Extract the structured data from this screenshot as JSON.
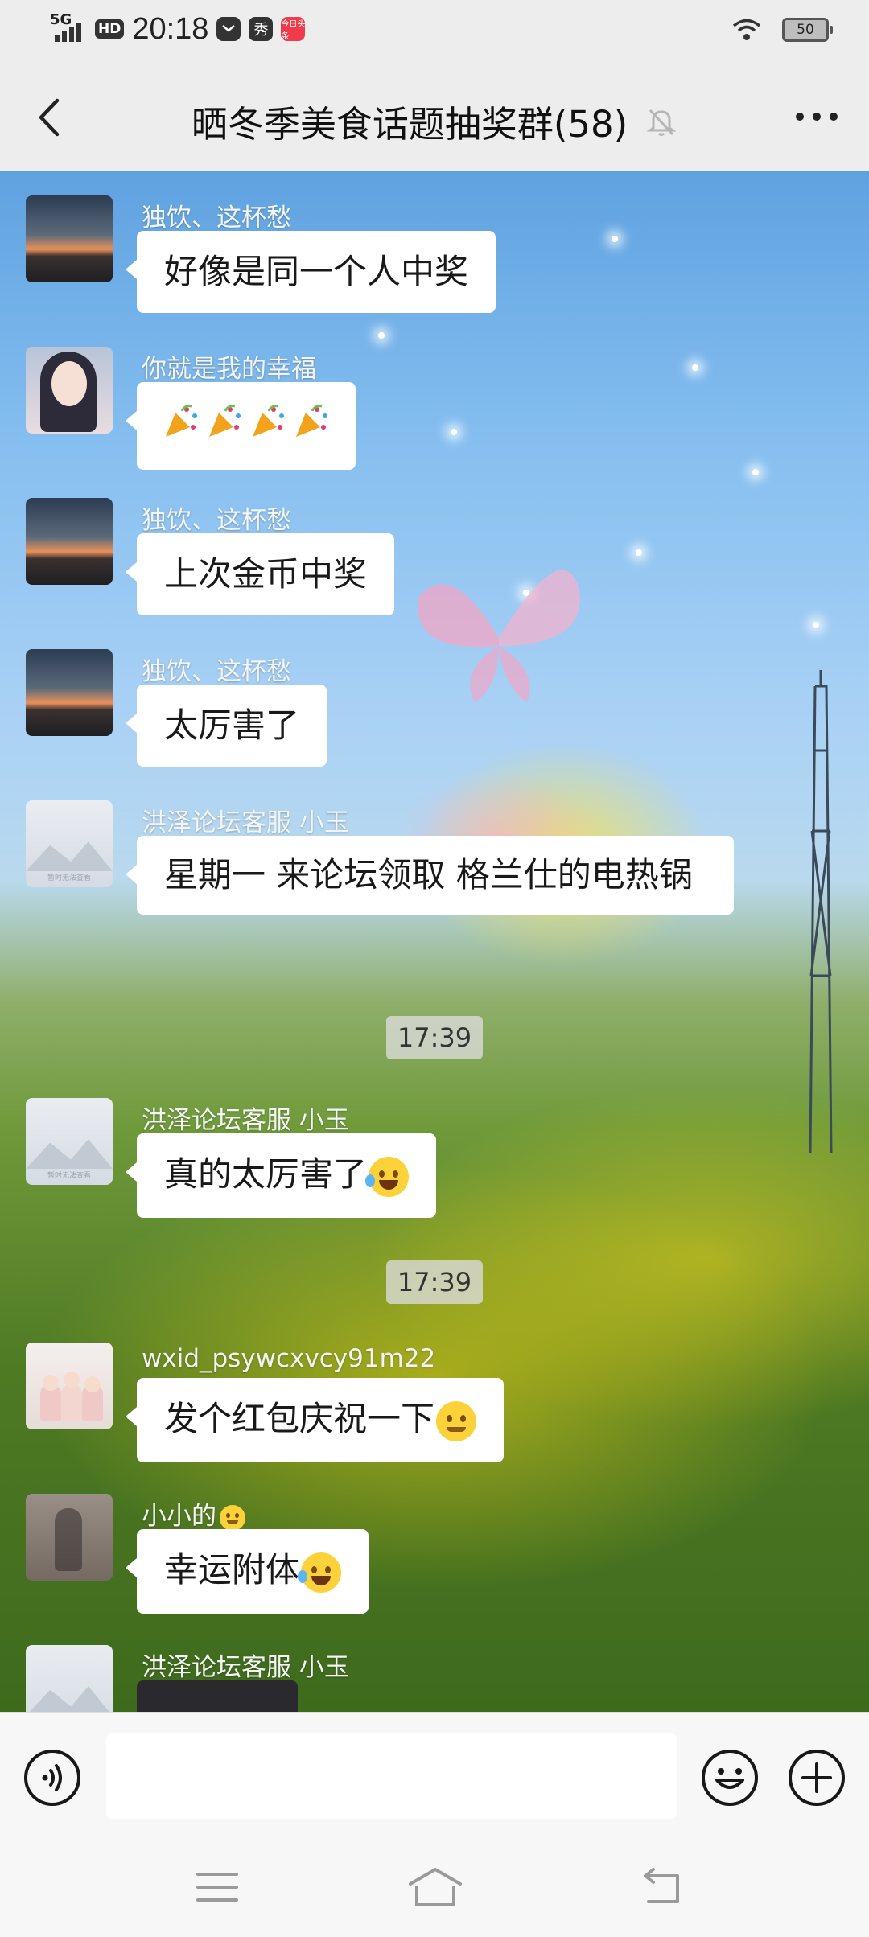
{
  "status_bar": {
    "network": "5G",
    "hd": "HD",
    "time": "20:18",
    "app_icon_2": "秀",
    "app_icon_3": "今日头条",
    "battery": "50"
  },
  "header": {
    "title": "晒冬季美食话题抽奖群(58)"
  },
  "messages": [
    {
      "sender": "独饮、这杯愁",
      "text": "好像是同一个人中奖"
    },
    {
      "sender": "你就是我的幸福",
      "text": ""
    },
    {
      "sender": "独饮、这杯愁",
      "text": "上次金币中奖"
    },
    {
      "sender": "独饮、这杯愁",
      "text": "太厉害了"
    },
    {
      "sender": "洪泽论坛客服 小玉",
      "text": "星期一 来论坛领取 格兰仕的电热锅",
      "avatar_caption": "暂时无法查看"
    },
    {
      "sender": "洪泽论坛客服 小玉",
      "text": "真的太厉害了",
      "avatar_caption": "暂时无法查看"
    },
    {
      "sender": "wxid_psywcxvcy91m22",
      "text": "发个红包庆祝一下"
    },
    {
      "sender": "小小的",
      "text": "幸运附体"
    },
    {
      "sender": "洪泽论坛客服 小玉",
      "text": ""
    }
  ],
  "timestamps": [
    "17:39",
    "17:39"
  ],
  "input": {
    "value": "",
    "placeholder": ""
  },
  "icons": {
    "back": "chevron-left-icon",
    "mute": "bell-off-icon",
    "more": "ellipsis-icon",
    "voice": "voice-icon",
    "emoji": "smiley-icon",
    "plus": "plus-icon",
    "nav_menu": "menu-icon",
    "nav_home": "home-icon",
    "nav_back": "back-arrow-icon"
  },
  "colors": {
    "background": "#ededed",
    "bubble": "#ffffff",
    "sender_text": "#f4f4f4"
  }
}
